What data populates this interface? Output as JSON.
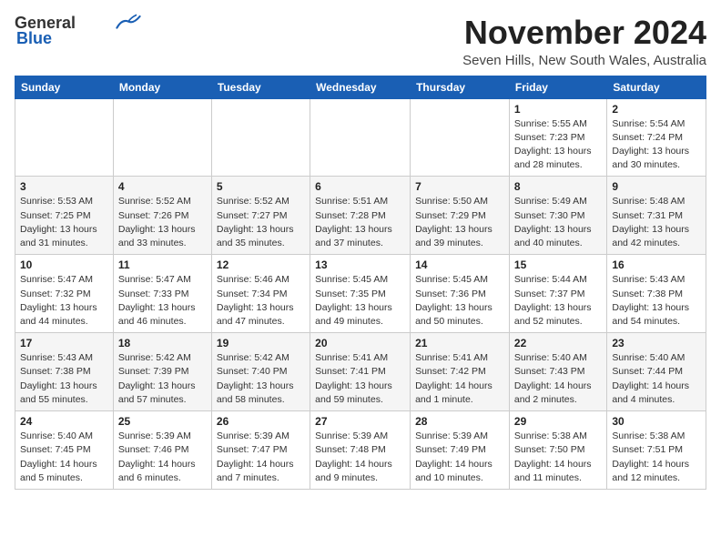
{
  "logo": {
    "line1": "General",
    "line2": "Blue"
  },
  "title": "November 2024",
  "subtitle": "Seven Hills, New South Wales, Australia",
  "days_header": [
    "Sunday",
    "Monday",
    "Tuesday",
    "Wednesday",
    "Thursday",
    "Friday",
    "Saturday"
  ],
  "weeks": [
    [
      {
        "day": "",
        "info": ""
      },
      {
        "day": "",
        "info": ""
      },
      {
        "day": "",
        "info": ""
      },
      {
        "day": "",
        "info": ""
      },
      {
        "day": "",
        "info": ""
      },
      {
        "day": "1",
        "info": "Sunrise: 5:55 AM\nSunset: 7:23 PM\nDaylight: 13 hours\nand 28 minutes."
      },
      {
        "day": "2",
        "info": "Sunrise: 5:54 AM\nSunset: 7:24 PM\nDaylight: 13 hours\nand 30 minutes."
      }
    ],
    [
      {
        "day": "3",
        "info": "Sunrise: 5:53 AM\nSunset: 7:25 PM\nDaylight: 13 hours\nand 31 minutes."
      },
      {
        "day": "4",
        "info": "Sunrise: 5:52 AM\nSunset: 7:26 PM\nDaylight: 13 hours\nand 33 minutes."
      },
      {
        "day": "5",
        "info": "Sunrise: 5:52 AM\nSunset: 7:27 PM\nDaylight: 13 hours\nand 35 minutes."
      },
      {
        "day": "6",
        "info": "Sunrise: 5:51 AM\nSunset: 7:28 PM\nDaylight: 13 hours\nand 37 minutes."
      },
      {
        "day": "7",
        "info": "Sunrise: 5:50 AM\nSunset: 7:29 PM\nDaylight: 13 hours\nand 39 minutes."
      },
      {
        "day": "8",
        "info": "Sunrise: 5:49 AM\nSunset: 7:30 PM\nDaylight: 13 hours\nand 40 minutes."
      },
      {
        "day": "9",
        "info": "Sunrise: 5:48 AM\nSunset: 7:31 PM\nDaylight: 13 hours\nand 42 minutes."
      }
    ],
    [
      {
        "day": "10",
        "info": "Sunrise: 5:47 AM\nSunset: 7:32 PM\nDaylight: 13 hours\nand 44 minutes."
      },
      {
        "day": "11",
        "info": "Sunrise: 5:47 AM\nSunset: 7:33 PM\nDaylight: 13 hours\nand 46 minutes."
      },
      {
        "day": "12",
        "info": "Sunrise: 5:46 AM\nSunset: 7:34 PM\nDaylight: 13 hours\nand 47 minutes."
      },
      {
        "day": "13",
        "info": "Sunrise: 5:45 AM\nSunset: 7:35 PM\nDaylight: 13 hours\nand 49 minutes."
      },
      {
        "day": "14",
        "info": "Sunrise: 5:45 AM\nSunset: 7:36 PM\nDaylight: 13 hours\nand 50 minutes."
      },
      {
        "day": "15",
        "info": "Sunrise: 5:44 AM\nSunset: 7:37 PM\nDaylight: 13 hours\nand 52 minutes."
      },
      {
        "day": "16",
        "info": "Sunrise: 5:43 AM\nSunset: 7:38 PM\nDaylight: 13 hours\nand 54 minutes."
      }
    ],
    [
      {
        "day": "17",
        "info": "Sunrise: 5:43 AM\nSunset: 7:38 PM\nDaylight: 13 hours\nand 55 minutes."
      },
      {
        "day": "18",
        "info": "Sunrise: 5:42 AM\nSunset: 7:39 PM\nDaylight: 13 hours\nand 57 minutes."
      },
      {
        "day": "19",
        "info": "Sunrise: 5:42 AM\nSunset: 7:40 PM\nDaylight: 13 hours\nand 58 minutes."
      },
      {
        "day": "20",
        "info": "Sunrise: 5:41 AM\nSunset: 7:41 PM\nDaylight: 13 hours\nand 59 minutes."
      },
      {
        "day": "21",
        "info": "Sunrise: 5:41 AM\nSunset: 7:42 PM\nDaylight: 14 hours\nand 1 minute."
      },
      {
        "day": "22",
        "info": "Sunrise: 5:40 AM\nSunset: 7:43 PM\nDaylight: 14 hours\nand 2 minutes."
      },
      {
        "day": "23",
        "info": "Sunrise: 5:40 AM\nSunset: 7:44 PM\nDaylight: 14 hours\nand 4 minutes."
      }
    ],
    [
      {
        "day": "24",
        "info": "Sunrise: 5:40 AM\nSunset: 7:45 PM\nDaylight: 14 hours\nand 5 minutes."
      },
      {
        "day": "25",
        "info": "Sunrise: 5:39 AM\nSunset: 7:46 PM\nDaylight: 14 hours\nand 6 minutes."
      },
      {
        "day": "26",
        "info": "Sunrise: 5:39 AM\nSunset: 7:47 PM\nDaylight: 14 hours\nand 7 minutes."
      },
      {
        "day": "27",
        "info": "Sunrise: 5:39 AM\nSunset: 7:48 PM\nDaylight: 14 hours\nand 9 minutes."
      },
      {
        "day": "28",
        "info": "Sunrise: 5:39 AM\nSunset: 7:49 PM\nDaylight: 14 hours\nand 10 minutes."
      },
      {
        "day": "29",
        "info": "Sunrise: 5:38 AM\nSunset: 7:50 PM\nDaylight: 14 hours\nand 11 minutes."
      },
      {
        "day": "30",
        "info": "Sunrise: 5:38 AM\nSunset: 7:51 PM\nDaylight: 14 hours\nand 12 minutes."
      }
    ]
  ]
}
